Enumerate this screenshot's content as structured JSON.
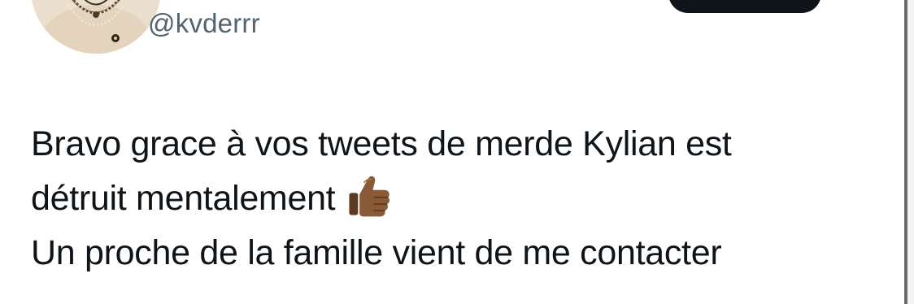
{
  "tweet": {
    "handle": "@kvderrr",
    "lines": [
      "Bravo grace à vos tweets de merde Kylian est",
      "détruit mentalement",
      "Un proche de la famille vient de me contacter"
    ],
    "emoji_icon": "thumbs-up-medium-dark-skin"
  },
  "colors": {
    "text": "#0f1419",
    "handle": "#536471",
    "button": "#0f1419"
  }
}
